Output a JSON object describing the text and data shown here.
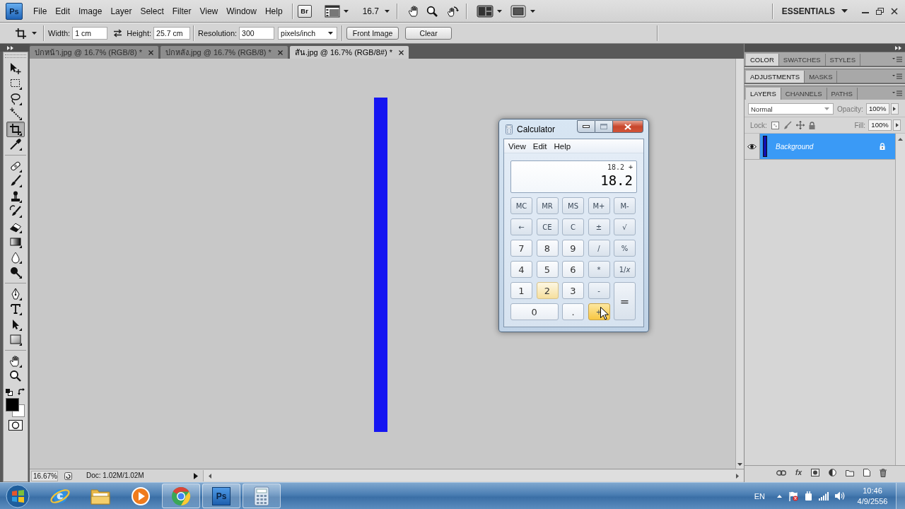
{
  "menubar": {
    "logo": "Ps",
    "menus": [
      "File",
      "Edit",
      "Image",
      "Layer",
      "Select",
      "Filter",
      "View",
      "Window",
      "Help"
    ],
    "bridge": "Br",
    "zoom": "16.7",
    "workspace": "ESSENTIALS"
  },
  "options_bar": {
    "fields": [
      {
        "label": "Width:",
        "value": "1 cm"
      },
      {
        "label": "Height:",
        "value": "25.7 cm"
      },
      {
        "label": "Resolution:",
        "value": "300"
      }
    ],
    "units": "pixels/inch",
    "buttons": [
      "Front Image",
      "Clear"
    ]
  },
  "document_tabs": [
    {
      "label": "ปกหน้า.jpg @ 16.7% (RGB/8) *",
      "selected": false
    },
    {
      "label": "ปกหลัง.jpg @ 16.7% (RGB/8) *",
      "selected": false
    },
    {
      "label": "สัน.jpg @ 16.7% (RGB/8#) *",
      "selected": true
    }
  ],
  "toolbox": {
    "groups": [
      [
        {
          "kind": "move",
          "selected": false
        },
        {
          "kind": "marquee",
          "selected": false
        },
        {
          "kind": "lasso",
          "selected": false
        },
        {
          "kind": "wand",
          "selected": false
        },
        {
          "kind": "crop",
          "selected": true
        },
        {
          "kind": "eyedropper",
          "selected": false
        }
      ],
      [
        {
          "kind": "healing",
          "selected": false
        },
        {
          "kind": "brush",
          "selected": false
        },
        {
          "kind": "stamp",
          "selected": false
        },
        {
          "kind": "history",
          "selected": false
        },
        {
          "kind": "eraser",
          "selected": false
        },
        {
          "kind": "gradient",
          "selected": false
        },
        {
          "kind": "blur",
          "selected": false
        },
        {
          "kind": "dodge",
          "selected": false
        }
      ],
      [
        {
          "kind": "pen",
          "selected": false
        },
        {
          "kind": "type",
          "selected": false
        },
        {
          "kind": "path",
          "selected": false
        },
        {
          "kind": "shape",
          "selected": false
        }
      ],
      [
        {
          "kind": "hand",
          "selected": false
        },
        {
          "kind": "zoom",
          "selected": false
        }
      ]
    ]
  },
  "status_bar": {
    "zoom": "16.67%",
    "document_size": "Doc: 1.02M/1.02M"
  },
  "panels": [
    {
      "expanded": false,
      "tabs": [
        {
          "label": "COLOR",
          "selected": true
        },
        {
          "label": "SWATCHES",
          "selected": false
        },
        {
          "label": "STYLES",
          "selected": false
        }
      ]
    },
    {
      "expanded": false,
      "tabs": [
        {
          "label": "ADJUSTMENTS",
          "selected": true
        },
        {
          "label": "MASKS",
          "selected": false
        }
      ]
    },
    {
      "expanded": true,
      "tabs": [
        {
          "label": "LAYERS",
          "selected": true
        },
        {
          "label": "CHANNELS",
          "selected": false
        },
        {
          "label": "PATHS",
          "selected": false
        }
      ]
    }
  ],
  "layers": {
    "blend_mode": "Normal",
    "opacity": {
      "label": "Opacity:",
      "value": "100%",
      "disabled": true
    },
    "lock": {
      "label": "Lock:",
      "disabled": true
    },
    "fill": {
      "label": "Fill:",
      "value": "100%",
      "disabled": true
    },
    "items": [
      {
        "name": "Background",
        "selected": true,
        "visible": true,
        "locked": true
      }
    ],
    "style_button": "fx"
  },
  "calculator": {
    "title": "Calculator",
    "menus": [
      "View",
      "Edit",
      "Help"
    ],
    "expression": "18.2 +",
    "display": "18.2",
    "keys": [
      {
        "label": "MC",
        "kind": "function",
        "hovered": false,
        "pressed": false
      },
      {
        "label": "MR",
        "kind": "function",
        "hovered": false,
        "pressed": false
      },
      {
        "label": "MS",
        "kind": "function",
        "hovered": false,
        "pressed": false
      },
      {
        "label": "M+",
        "kind": "function",
        "hovered": false,
        "pressed": false
      },
      {
        "label": "M-",
        "kind": "function",
        "hovered": false,
        "pressed": false
      },
      {
        "label": "←",
        "kind": "function",
        "hovered": false,
        "pressed": false
      },
      {
        "label": "CE",
        "kind": "function",
        "hovered": false,
        "pressed": false
      },
      {
        "label": "C",
        "kind": "function",
        "hovered": false,
        "pressed": false
      },
      {
        "label": "±",
        "kind": "function",
        "hovered": false,
        "pressed": false
      },
      {
        "label": "√",
        "kind": "function",
        "hovered": false,
        "pressed": false
      },
      {
        "label": "7",
        "kind": "digit",
        "hovered": false,
        "pressed": false
      },
      {
        "label": "8",
        "kind": "digit",
        "hovered": false,
        "pressed": false
      },
      {
        "label": "9",
        "kind": "digit",
        "hovered": false,
        "pressed": false
      },
      {
        "label": "/",
        "kind": "function",
        "hovered": false,
        "pressed": false
      },
      {
        "label": "%",
        "kind": "function",
        "hovered": false,
        "pressed": false
      },
      {
        "label": "4",
        "kind": "digit",
        "hovered": false,
        "pressed": false
      },
      {
        "label": "5",
        "kind": "digit",
        "hovered": false,
        "pressed": false
      },
      {
        "label": "6",
        "kind": "digit",
        "hovered": false,
        "pressed": false
      },
      {
        "label": "*",
        "kind": "function",
        "hovered": false,
        "pressed": false
      },
      {
        "label": "1/*x*",
        "kind": "function",
        "hovered": false,
        "pressed": false
      },
      {
        "label": "1",
        "kind": "digit",
        "hovered": false,
        "pressed": false
      },
      {
        "label": "2",
        "kind": "digit",
        "hovered": true,
        "pressed": false
      },
      {
        "label": "3",
        "kind": "digit",
        "hovered": false,
        "pressed": false
      },
      {
        "label": "-",
        "kind": "function",
        "hovered": false,
        "pressed": false
      },
      {
        "label": "=",
        "kind": "equals",
        "hovered": false,
        "pressed": false
      },
      {
        "label": "0",
        "kind": "zero",
        "hovered": false,
        "pressed": false
      },
      {
        "label": ".",
        "kind": "digit",
        "hovered": false,
        "pressed": false
      },
      {
        "label": "+",
        "kind": "function",
        "hovered": false,
        "pressed": true
      }
    ]
  },
  "taskbar": {
    "apps": [
      {
        "kind": "ie",
        "running": false
      },
      {
        "kind": "explorer",
        "running": false
      },
      {
        "kind": "media",
        "running": false
      },
      {
        "kind": "chrome",
        "running": true
      },
      {
        "kind": "photoshop",
        "label": "Ps",
        "running": true
      },
      {
        "kind": "calculator",
        "running": true
      }
    ],
    "language": "EN",
    "time": "10:46",
    "date": "4/9/2556"
  }
}
